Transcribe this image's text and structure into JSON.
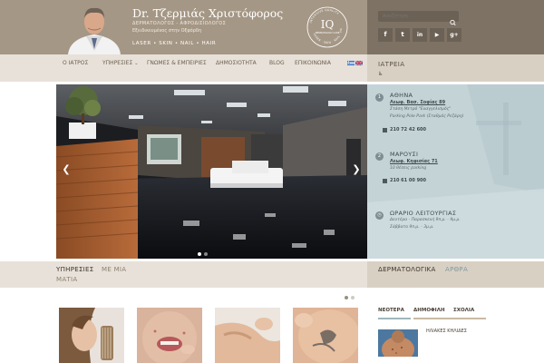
{
  "header": {
    "doctor_name": "Dr. Τζερμιάς Χριστόφορος",
    "specialty": "ΔΕΡΜΑΤΟΛΟΓΟΣ - ΑΦΡΟΔΙΣΙΟΛΟΓΟΣ",
    "subtitle": "Εξειδικευμένος στην Οξφόρδη",
    "tagline": "LASER • SKIN • NAIL • HAIR",
    "logo_text": "IQ",
    "logo_ring_text": "INTENSIVE QUALITY",
    "logo_sub": "DERMATOLOGY CARE",
    "logo_bottom": "LASER · SKIN · NAIL · HAIR",
    "search_placeholder": "Αναζήτηση"
  },
  "social": [
    {
      "name": "facebook",
      "glyph": "f"
    },
    {
      "name": "twitter",
      "glyph": "t"
    },
    {
      "name": "linkedin",
      "glyph": "in"
    },
    {
      "name": "youtube",
      "glyph": "▶"
    },
    {
      "name": "googleplus",
      "glyph": "g+"
    }
  ],
  "nav": {
    "items": [
      "Ο ΙΑΤΡΟΣ",
      "ΥΠΗΡΕΣΙΕΣ",
      "ΓΝΩΜΕΣ & ΕΜΠΕΙΡΙΕΣ",
      "ΔΗΜΟΣΙΟΤΗΤΑ",
      "BLOG",
      "ΕΠΙΚΟΙΝΩΝΙΑ"
    ],
    "iatreia": "ΙΑΤΡΕΙΑ",
    "wheelchair": "♿"
  },
  "slider": {
    "prev": "❮",
    "next": "❯",
    "slides": 2,
    "active": 1
  },
  "contact": {
    "athens": {
      "title": "ΑΘΗΝΑ",
      "address": "Λεωφ. Βασ. Σοφίας 89",
      "note1": "Στάση Μετρό \"Ευαγγελισμός\"",
      "note2": "Parking Pole Park (Σταθμός Ρεζάρη)",
      "phone": "210 72 42 600"
    },
    "marousi": {
      "title": "ΜΑΡΟΥΣΙ",
      "address": "Λεωφ. Κηφισίας 71",
      "note1": "10 θέσεις parking",
      "phone": "210 61 00 900"
    },
    "hours": {
      "title": "ΩΡΑΡΙΟ ΛΕΙΤΟΥΡΓΙΑΣ",
      "line1": "Δευτέρα - Παρασκευή 9π.μ. - 9μ.μ.",
      "line2": "Σάββατο 9π.μ. - 3μ.μ."
    }
  },
  "sections": {
    "services_title": "ΥΠΗΡΕΣΙΕΣ",
    "services_sub1": "ΜΕ ΜΙΑ",
    "services_sub2": "ΜΑΤΙΑ",
    "derm_title": "ΔΕΡΜΑΤΟΛΟΓΙΚΑ",
    "derm_sub": "ΑΡΘΡΑ"
  },
  "tabs": {
    "newest": "ΝΕΟΤΕΡΑ",
    "popular": "ΔΗΜΟΦΙΛΗ",
    "comments": "ΣΧΟΛΙΑ"
  },
  "news": {
    "title": "ΗΛΙΑΚΕΣ ΚΗΛΙΔΕΣ"
  },
  "colors": {
    "header": "#a59785",
    "header_dark": "#7e7265",
    "nav": "#e7e1d9",
    "contact": "#c7d6d9",
    "tab_newest": "#9fb7bd",
    "tab_popular": "#c9b9a3"
  }
}
